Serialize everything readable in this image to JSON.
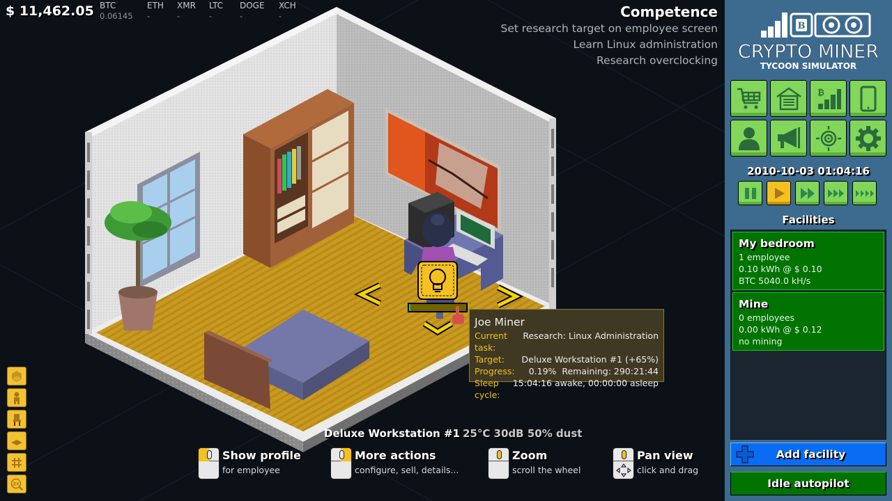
{
  "hud": {
    "money": "$ 11,462.05",
    "coins": [
      {
        "symbol": "BTC",
        "value": "0.06145"
      },
      {
        "symbol": "ETH",
        "value": "-"
      },
      {
        "symbol": "XMR",
        "value": "-"
      },
      {
        "symbol": "LTC",
        "value": "-"
      },
      {
        "symbol": "DOGE",
        "value": "-"
      },
      {
        "symbol": "XCH",
        "value": "-"
      }
    ]
  },
  "objectives": {
    "title": "Competence",
    "items": [
      "Set research target on employee screen",
      "Learn Linux administration",
      "Research overclocking"
    ]
  },
  "tools": [
    "build-room-icon",
    "employee-icon",
    "furniture-icon",
    "floor-icon",
    "grid-icon",
    "zoom-2x-icon"
  ],
  "scene": {
    "workstation_status": {
      "name": "Deluxe Workstation #1",
      "stats": "25°C 30dB 50% dust"
    },
    "task_icon": "lightbulb-icon",
    "task_progress_fraction": 0.0019
  },
  "tooltip": {
    "name": "Joe Miner",
    "rows": [
      {
        "key": "Current task:",
        "value": "Research: Linux Administration"
      },
      {
        "key": "Target:",
        "value": "Deluxe Workstation #1 (+65%)"
      },
      {
        "key": "Progress:",
        "value": "0.19%  Remaining: 290:21:44"
      },
      {
        "key": "Sleep cycle:",
        "value": "15:04:16 awake, 00:00:00 asleep"
      }
    ]
  },
  "hints": [
    {
      "title": "Show profile",
      "subtitle": "for employee",
      "button": "left"
    },
    {
      "title": "More actions",
      "subtitle": "configure, sell, details...",
      "button": "right"
    },
    {
      "title": "Zoom",
      "subtitle": "scroll the wheel",
      "button": "wheel"
    },
    {
      "title": "Pan view",
      "subtitle": "click and drag",
      "button": "wheel-drag"
    }
  ],
  "sidebar": {
    "logo": {
      "title": "CRYPTO MINER",
      "subtitle": "TYCOON SIMULATOR"
    },
    "menu": [
      {
        "name": "shop",
        "icon": "cart-icon"
      },
      {
        "name": "warehouse",
        "icon": "garage-icon"
      },
      {
        "name": "market",
        "icon": "bitcoin-chart-icon"
      },
      {
        "name": "phone",
        "icon": "smartphone-icon"
      },
      {
        "name": "employees",
        "icon": "person-icon"
      },
      {
        "name": "marketing",
        "icon": "megaphone-icon"
      },
      {
        "name": "targets",
        "icon": "crosshair-icon"
      },
      {
        "name": "settings",
        "icon": "gear-icon"
      }
    ],
    "datetime": "2010-10-03 01:04:16",
    "speeds": [
      {
        "name": "pause",
        "active": false
      },
      {
        "name": "play",
        "active": true
      },
      {
        "name": "fast",
        "active": false
      },
      {
        "name": "faster",
        "active": false
      },
      {
        "name": "fastest",
        "active": false
      }
    ],
    "facilities_title": "Facilities",
    "facilities": [
      {
        "name": "My bedroom",
        "employees": "1 employee",
        "power": "0.10 kWh @ $ 0.10",
        "mining": "BTC 5040.0 kH/s"
      },
      {
        "name": "Mine",
        "employees": "0 employees",
        "power": "0.00 kWh @ $ 0.12",
        "mining": "no mining"
      }
    ],
    "add_facility_label": "Add facility",
    "autopilot_label": "Idle autopilot"
  },
  "colors": {
    "accent_yellow": "#f5c120",
    "menu_green": "#82d65a",
    "facility_green": "#007300",
    "add_blue": "#0a6cf2",
    "sidebar_bg": "#3d6a8f"
  }
}
